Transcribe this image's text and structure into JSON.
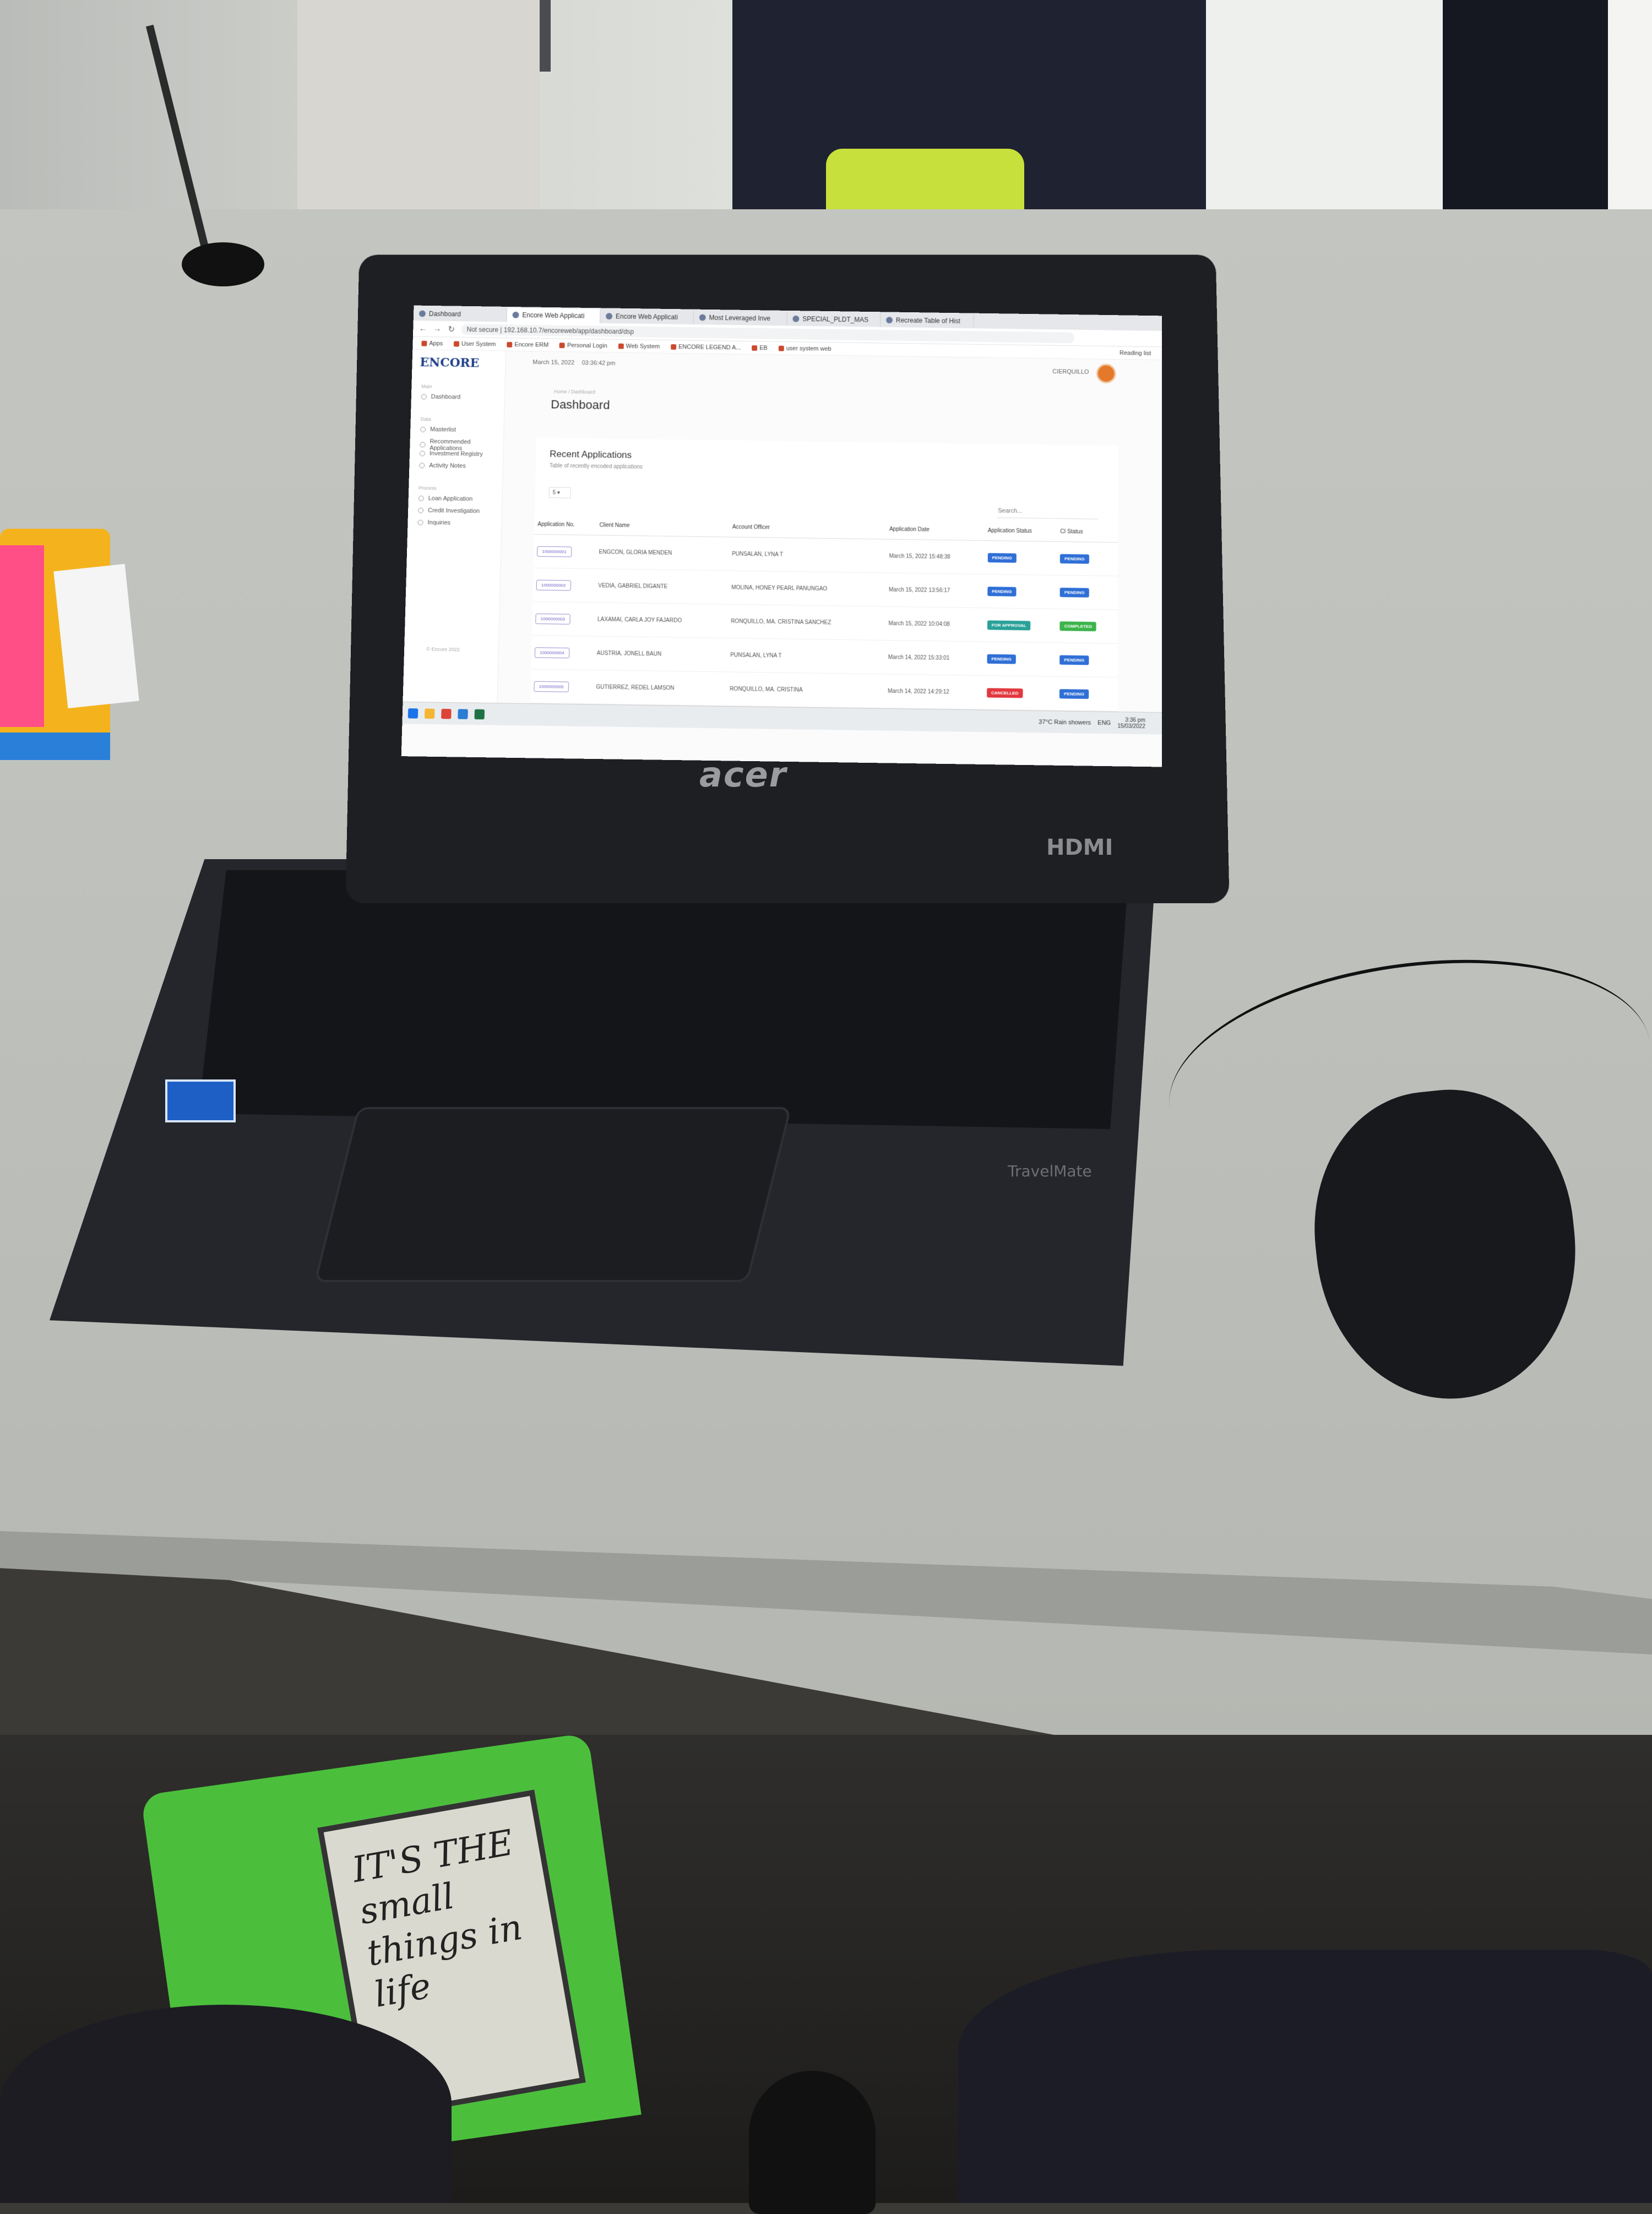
{
  "browser": {
    "tabs": [
      {
        "label": "Dashboard",
        "active": false
      },
      {
        "label": "Encore Web Applicati",
        "active": true
      },
      {
        "label": "Encore Web Applicati",
        "active": false
      },
      {
        "label": "Most Leveraged Inve",
        "active": false
      },
      {
        "label": "SPECIAL_PLDT_MAS",
        "active": false
      },
      {
        "label": "Recreate Table of Hist",
        "active": false
      }
    ],
    "url": "Not secure | 192.168.10.7/encoreweb/app/dashboard/dsp",
    "bookmarks": [
      "Apps",
      "User System",
      "Encore ERM",
      "Personal Login",
      "Web System",
      "ENCORE LEGEND A...",
      "EB",
      "user system web"
    ],
    "reading_list": "Reading list"
  },
  "app": {
    "logo": "ENCORE",
    "date": "March 15, 2022",
    "time": "03:36:42 pm",
    "user": "CIERQUILLO",
    "sidebar": {
      "sections": [
        {
          "header": "Main",
          "items": [
            "Dashboard"
          ]
        },
        {
          "header": "Data",
          "items": [
            "Masterlist",
            "Recommended Applications",
            "Investment Registry",
            "Activity Notes"
          ]
        },
        {
          "header": "Process",
          "items": [
            "Loan Application",
            "Credit Investigation",
            "Inquiries"
          ]
        }
      ],
      "footer": "© Encore 2022"
    },
    "breadcrumb": "Home / Dashboard",
    "title": "Dashboard",
    "card": {
      "title": "Recent Applications",
      "subtitle": "Table of recently encoded applications",
      "length": "5",
      "search_placeholder": "Search...",
      "columns": [
        "Application No.",
        "Client Name",
        "Account Officer",
        "Application Date",
        "Application Status",
        "CI Status"
      ],
      "rows": [
        {
          "app_no": "1000000001",
          "client": "ENGCON, GLORIA MENDEN",
          "officer": "PUNSALAN, LYNA T",
          "date": "March 15, 2022 15:48:38",
          "status": "PENDING",
          "ci": "PENDING"
        },
        {
          "app_no": "1000000002",
          "client": "VEDIA, GABRIEL DIGANTE",
          "officer": "MOLINA, HONEY PEARL PANUNGAO",
          "date": "March 15, 2022 13:56:17",
          "status": "PENDING",
          "ci": "PENDING"
        },
        {
          "app_no": "1000000003",
          "client": "LAXAMAI, CARLA JOY FAJARDO",
          "officer": "RONQUILLO, MA. CRISTINA SANCHEZ",
          "date": "March 15, 2022 10:04:08",
          "status": "FOR APPROVAL",
          "ci": "COMPLETED"
        },
        {
          "app_no": "1000000004",
          "client": "AUSTRIA, JONELL BAUN",
          "officer": "PUNSALAN, LYNA T",
          "date": "March 14, 2022 15:33:01",
          "status": "PENDING",
          "ci": "PENDING"
        },
        {
          "app_no": "1000000005",
          "client": "GUTIERREZ, REDEL LAMSON",
          "officer": "RONQUILLO, MA. CRISTINA",
          "date": "March 14, 2022 14:29:12",
          "status": "CANCELLED",
          "ci": "PENDING"
        }
      ]
    }
  },
  "taskbar": {
    "weather": "37°C  Rain showers",
    "lang": "ENG",
    "time": "3:36 pm",
    "date": "15/03/2022"
  },
  "hardware": {
    "brand": "acer",
    "port_label": "HDMI",
    "model": "TravelMate",
    "bag_text": "IT'S THE small things in life"
  },
  "colors": {
    "pending": "#2f6fd6",
    "for_approval": "#2aa198",
    "completed": "#3cb44b",
    "cancelled": "#e2383f"
  }
}
